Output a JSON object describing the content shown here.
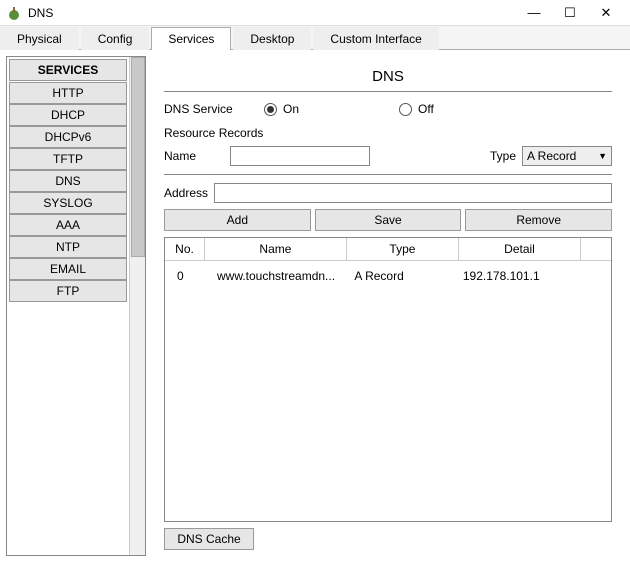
{
  "window": {
    "title": "DNS"
  },
  "tabs": [
    "Physical",
    "Config",
    "Services",
    "Desktop",
    "Custom Interface"
  ],
  "activeTab": "Services",
  "sidebar": {
    "header": "SERVICES",
    "items": [
      "HTTP",
      "DHCP",
      "DHCPv6",
      "TFTP",
      "DNS",
      "SYSLOG",
      "AAA",
      "NTP",
      "EMAIL",
      "FTP"
    ]
  },
  "main": {
    "title": "DNS",
    "serviceLabel": "DNS Service",
    "onLabel": "On",
    "offLabel": "Off",
    "serviceState": "on",
    "resourceRecordsLabel": "Resource Records",
    "nameLabel": "Name",
    "nameValue": "",
    "typeLabel": "Type",
    "typeValue": "A Record",
    "addressLabel": "Address",
    "addressValue": "",
    "buttons": {
      "add": "Add",
      "save": "Save",
      "remove": "Remove"
    },
    "table": {
      "headers": {
        "no": "No.",
        "name": "Name",
        "type": "Type",
        "detail": "Detail"
      },
      "rows": [
        {
          "no": "0",
          "name": "www.touchstreamdn...",
          "type": "A Record",
          "detail": "192.178.101.1"
        }
      ]
    },
    "cacheButton": "DNS Cache"
  }
}
